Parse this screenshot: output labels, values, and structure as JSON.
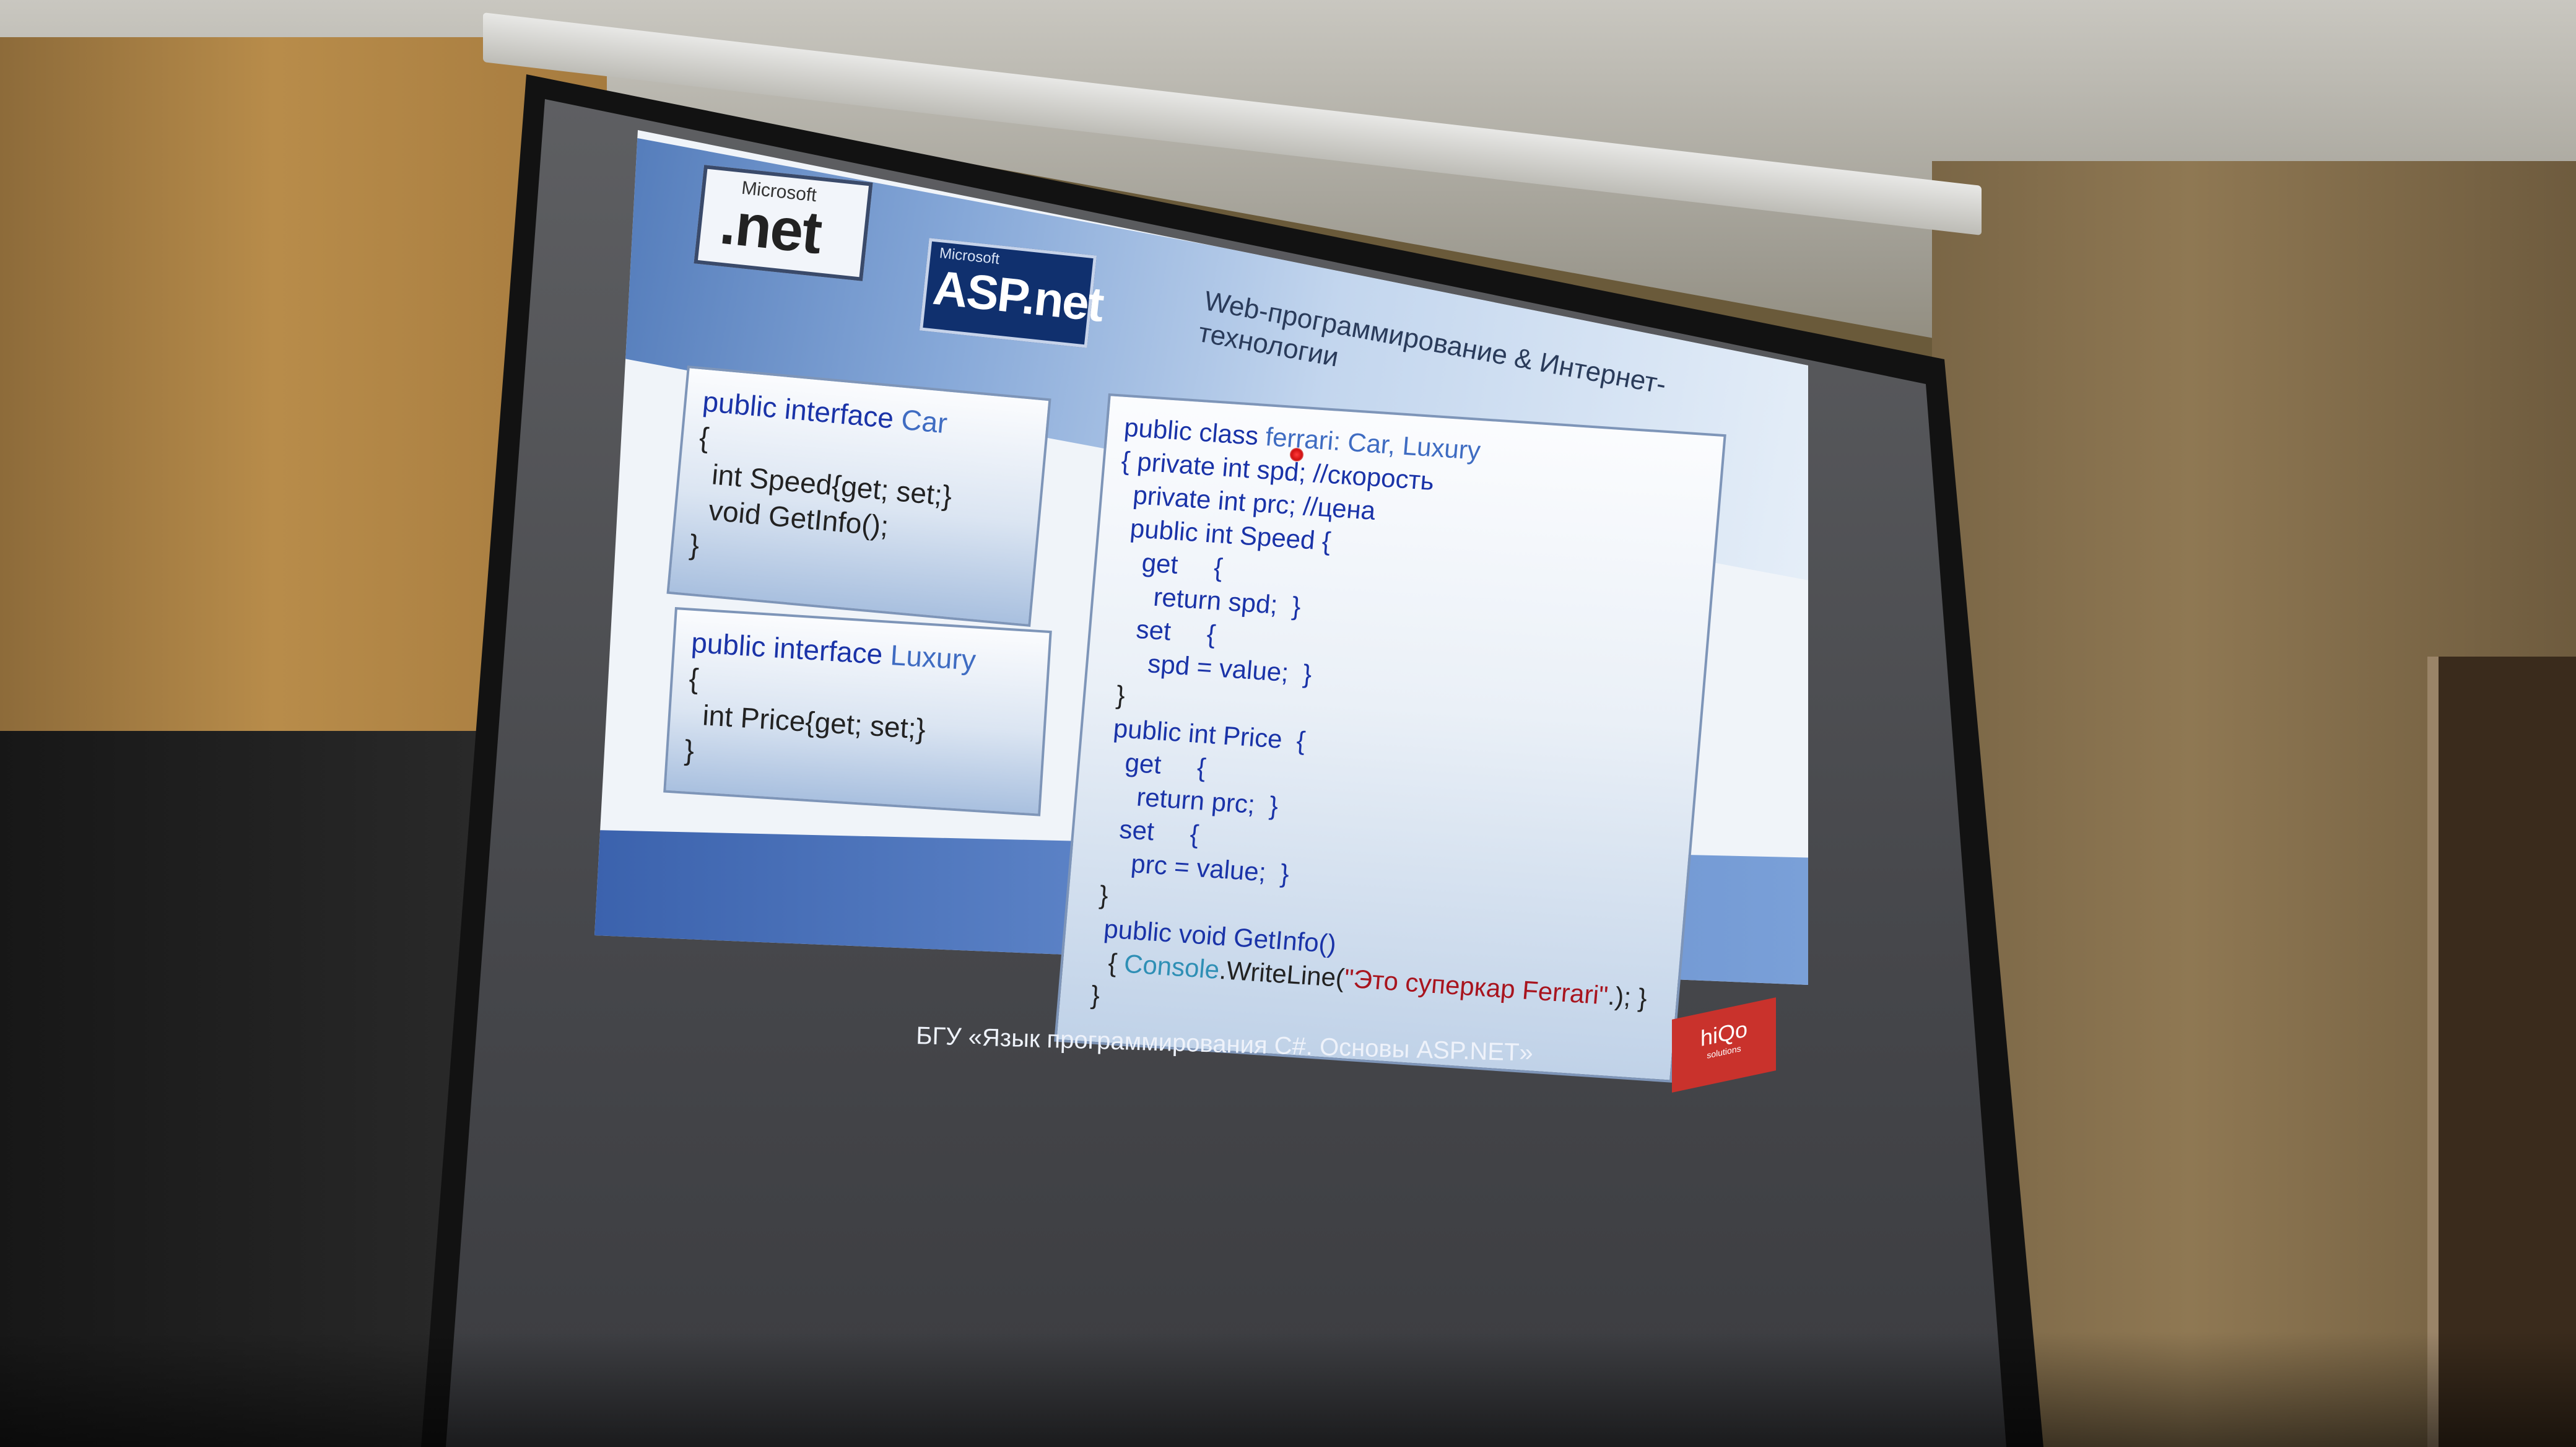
{
  "slide": {
    "logos": {
      "net": {
        "ms": "Microsoft",
        "text": ".net"
      },
      "asp": {
        "ms": "Microsoft",
        "text": "ASP.net"
      }
    },
    "header_title": "Web-программирование & Интернет-технологии",
    "box_car": {
      "lines": [
        {
          "kw": "public interface ",
          "ty": "Car"
        },
        {
          "text": "{"
        },
        {
          "text": "  int Speed{get; set;}"
        },
        {
          "text": "  void GetInfo();"
        },
        {
          "text": "}"
        }
      ]
    },
    "box_luxury": {
      "lines": [
        {
          "kw": "public interface ",
          "ty": "Luxury"
        },
        {
          "text": "{"
        },
        {
          "text": "  int Price{get; set;}"
        },
        {
          "text": "}"
        }
      ]
    },
    "box_ferrari": {
      "l01_kw": "public class ",
      "l01_ty": "ferrari",
      "l01_rest": ": Car, Luxury",
      "l02": "{ private int spd; //скорость",
      "l03": "  private int prc; //цена",
      "l04": "  public int Speed {",
      "l05": "    get     {",
      "l06": "      return spd;  }",
      "l07": "    set     {",
      "l08": "      spd = value;  }",
      "l09": "  }",
      "l10": "  public int Price  {",
      "l11": "    get     {",
      "l12": "      return prc;  }",
      "l13": "    set     {",
      "l14": "      prc = value;  }",
      "l15": "  }",
      "l16": "   public void GetInfo()",
      "l17_a": "    { ",
      "l17_cs": "Console",
      "l17_b": ".WriteLine(",
      "l17_str": "\"Это суперкар Ferrari\"",
      "l17_c": ".); }",
      "l18": "  }"
    },
    "footer": "БГУ  «Язык программирования C#. Основы ASP.NET»",
    "hiqo": {
      "name": "hiQo",
      "sub": "solutions"
    }
  }
}
